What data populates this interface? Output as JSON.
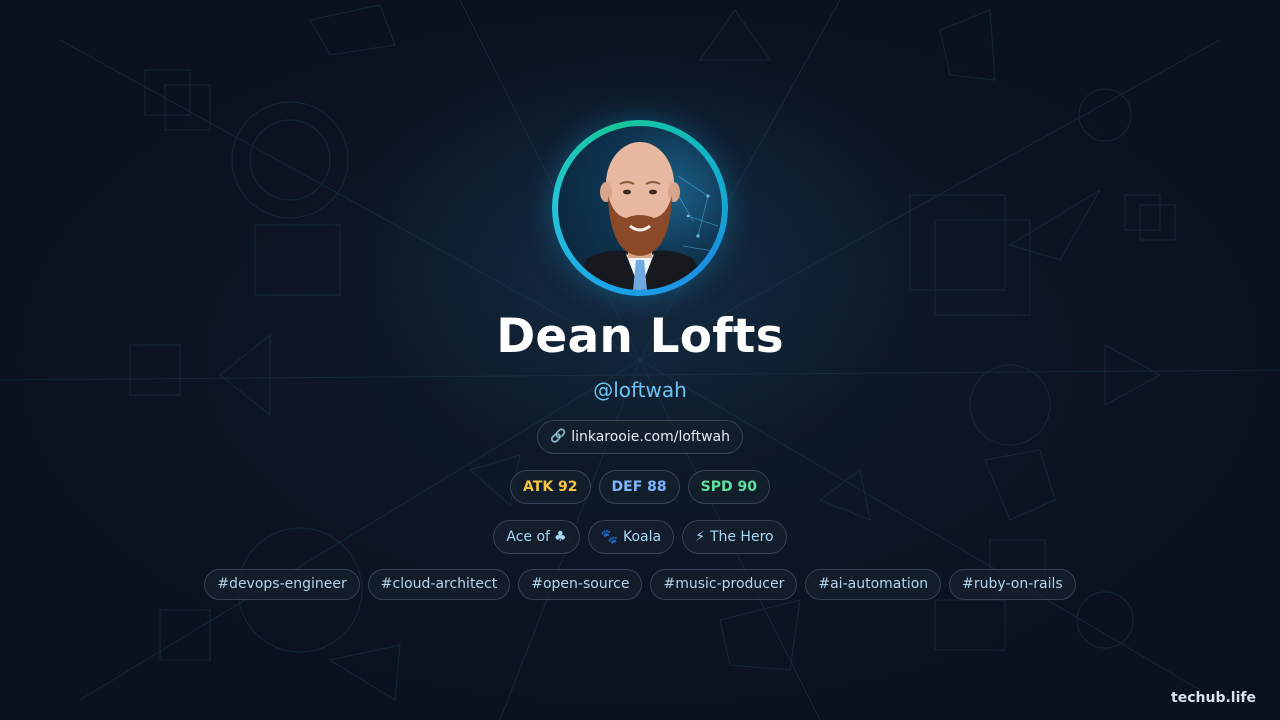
{
  "profile": {
    "name": "Dean Lofts",
    "handle": "@loftwah",
    "avatar_alt": "profile photo"
  },
  "link": {
    "icon": "link-icon",
    "icon_glyph": "🔗",
    "text": "linkarooie.com/loftwah"
  },
  "stats": [
    {
      "label": "ATK 92",
      "color": "#f5c542"
    },
    {
      "label": "DEF 88",
      "color": "#7db6ff"
    },
    {
      "label": "SPD 90",
      "color": "#5ee0a0"
    }
  ],
  "badges": {
    "ace": {
      "text": "Ace of",
      "suit": "♣"
    },
    "koala": {
      "icon": "paw-icon",
      "glyph": "🐾",
      "text": "Koala"
    },
    "hero": {
      "icon": "lightning-icon",
      "glyph": "⚡",
      "text": "The Hero"
    }
  },
  "tags": [
    "#devops-engineer",
    "#cloud-architect",
    "#open-source",
    "#music-producer",
    "#ai-automation",
    "#ruby-on-rails"
  ],
  "brand": "techub.life",
  "colors": {
    "background": "#0b1320",
    "accent_ring_start": "#1aa3e8",
    "accent_ring_end": "#17c79a",
    "handle": "#6fc3f2"
  }
}
